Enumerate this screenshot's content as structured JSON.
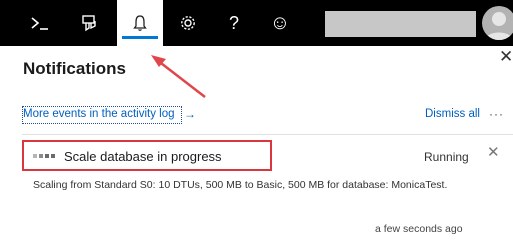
{
  "toolbar": {
    "items": [
      {
        "icon": "cloud-shell-icon"
      },
      {
        "icon": "directory-filter-icon"
      },
      {
        "icon": "bell-icon",
        "active": true
      },
      {
        "icon": "gear-icon"
      },
      {
        "icon": "help-icon",
        "label": "?"
      },
      {
        "icon": "smiley-icon",
        "label": "☺"
      }
    ],
    "accent_color": "#0078d4"
  },
  "panel": {
    "title": "Notifications",
    "close_glyph": "✕",
    "activity_link": "More events in the activity log",
    "activity_arrow": "→",
    "dismiss_all": "Dismiss all",
    "more_glyph": "···"
  },
  "notification": {
    "title": "Scale database in progress",
    "status": "Running",
    "close_glyph": "✕",
    "description": "Scaling from Standard S0: 10 DTUs, 500 MB to Basic, 500 MB for database: MonicaTest.",
    "time": "a few seconds ago"
  },
  "annotation": {
    "highlight_color": "#d9363e"
  }
}
